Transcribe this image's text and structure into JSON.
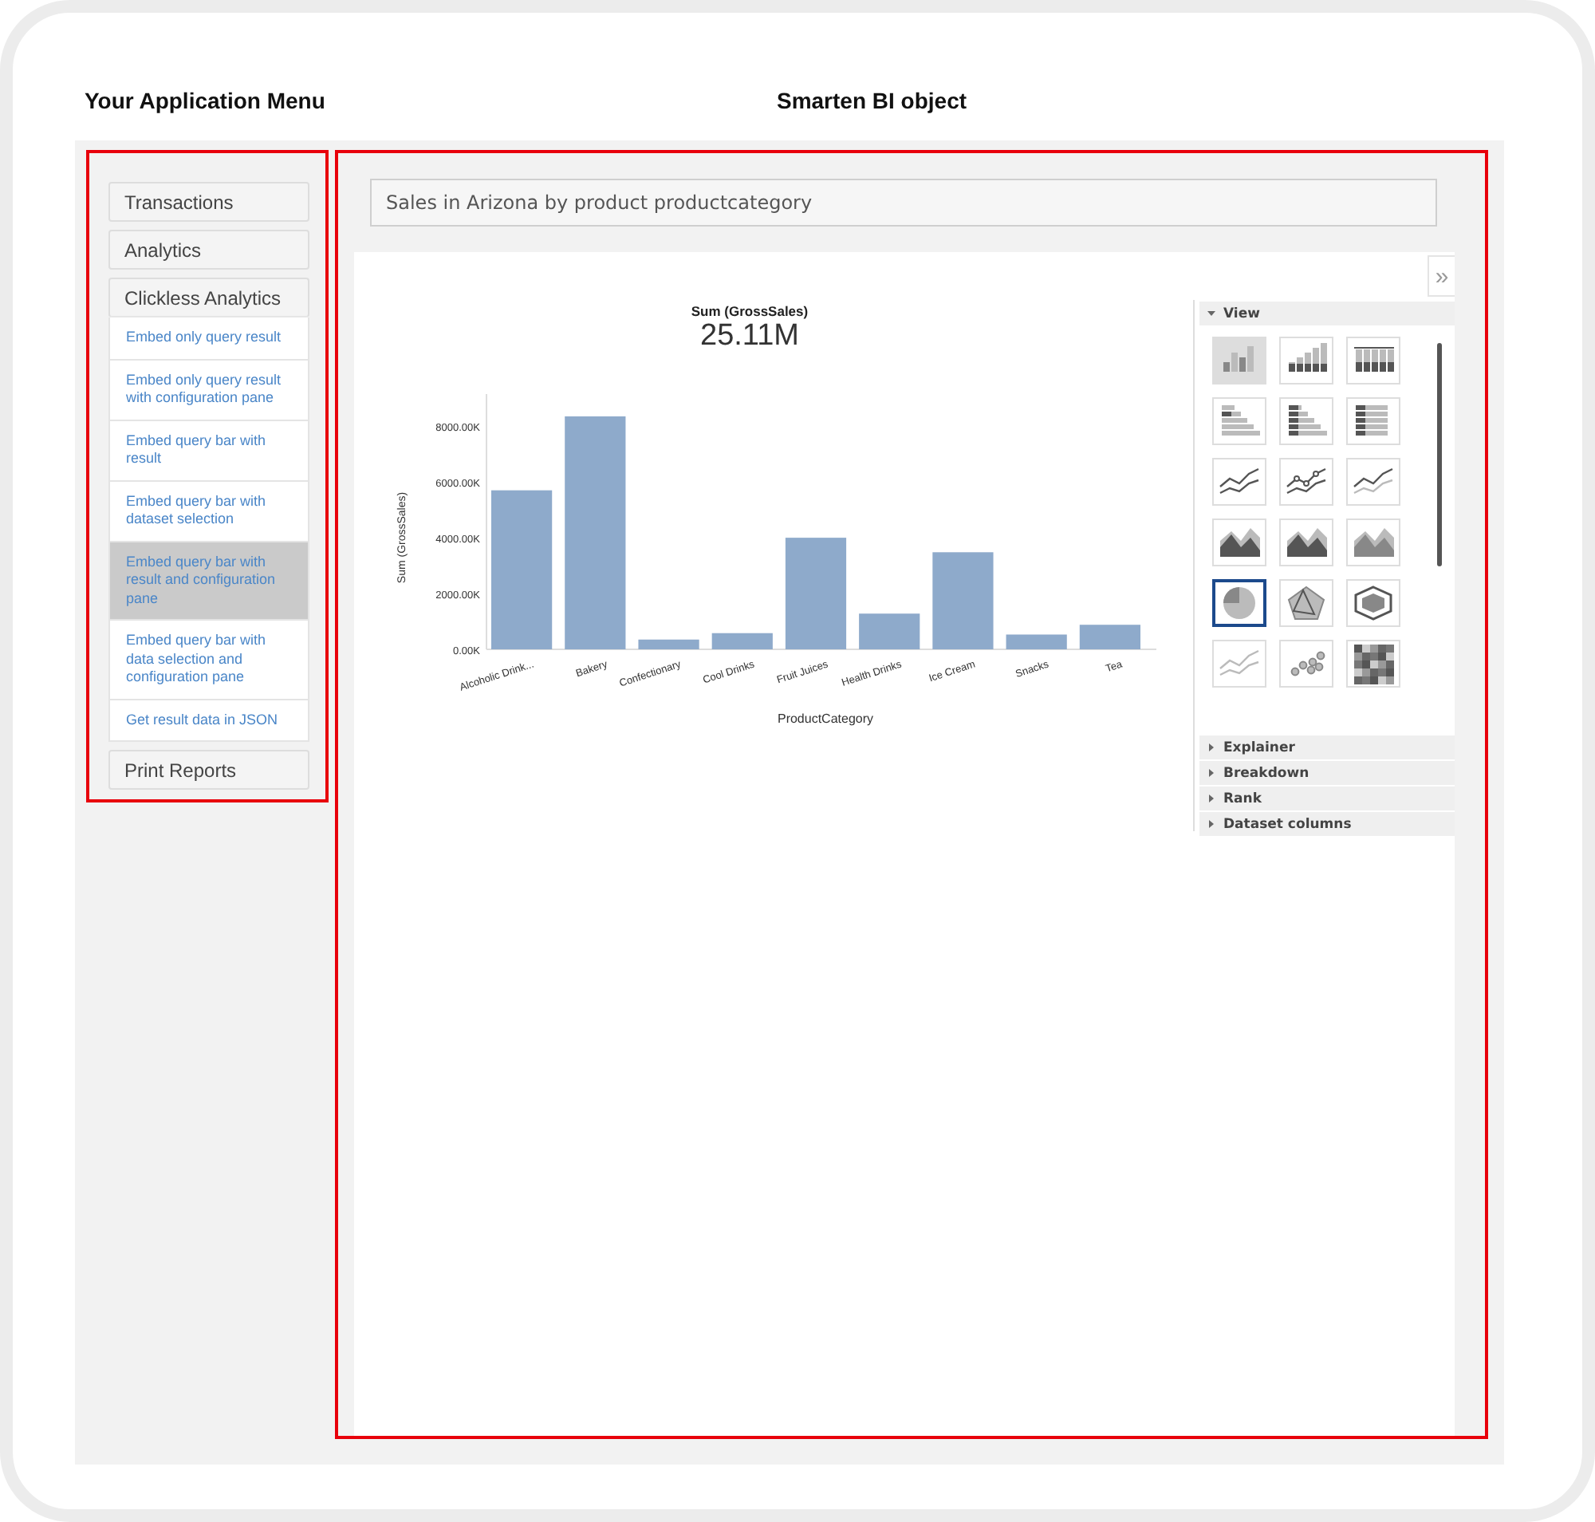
{
  "headings": {
    "menu": "Your Application Menu",
    "object": "Smarten BI object"
  },
  "menu": [
    {
      "label": "Transactions"
    },
    {
      "label": "Analytics"
    },
    {
      "label": "Clickless Analytics",
      "children": [
        {
          "label": "Embed only query result",
          "selected": false
        },
        {
          "label": "Embed only query result with configuration pane",
          "selected": false
        },
        {
          "label": "Embed query bar with result",
          "selected": false
        },
        {
          "label": "Embed query bar with dataset selection",
          "selected": false
        },
        {
          "label": "Embed query bar with result and configuration pane",
          "selected": true
        },
        {
          "label": "Embed query bar with data selection and configuration pane",
          "selected": false
        },
        {
          "label": "Get result data in JSON",
          "selected": false
        }
      ]
    },
    {
      "label": "Print Reports"
    }
  ],
  "query": {
    "value": "Sales in Arizona by product productcategory"
  },
  "expand_button": "»",
  "kpi": {
    "label": "Sum (GrossSales)",
    "value": "25.11M"
  },
  "chart_data": {
    "type": "bar",
    "xlabel": "ProductCategory",
    "ylabel": "Sum (GrossSales)",
    "categories": [
      "Alcoholic Drink...",
      "Bakery",
      "Confectionary",
      "Cool Drinks",
      "Fruit Juices",
      "Health Drinks",
      "Ice Cream",
      "Snacks",
      "Tea"
    ],
    "series": [
      {
        "color": "#8eaacb",
        "values": [
          5700,
          8350,
          350,
          580,
          4000,
          1280,
          3480,
          530,
          880
        ]
      }
    ],
    "ylim": [
      0,
      9150
    ],
    "yticks": [
      {
        "value": 0,
        "label": "0.00K"
      },
      {
        "value": 2000,
        "label": "2000.00K"
      },
      {
        "value": 4000,
        "label": "4000.00K"
      },
      {
        "value": 6000,
        "label": "6000.00K"
      },
      {
        "value": 8000,
        "label": "8000.00K"
      }
    ]
  },
  "panel": {
    "sections": [
      {
        "label": "View",
        "expanded": true
      },
      {
        "label": "Explainer",
        "expanded": false
      },
      {
        "label": "Breakdown",
        "expanded": false
      },
      {
        "label": "Rank",
        "expanded": false
      },
      {
        "label": "Dataset columns",
        "expanded": false
      }
    ],
    "chart_types": [
      {
        "kind": "column",
        "selected": false,
        "highlighted": true
      },
      {
        "kind": "stacked-column",
        "selected": false,
        "highlighted": false
      },
      {
        "kind": "percent-column",
        "selected": false,
        "highlighted": false
      },
      {
        "kind": "bar",
        "selected": false,
        "highlighted": false
      },
      {
        "kind": "stacked-bar",
        "selected": false,
        "highlighted": false
      },
      {
        "kind": "percent-bar",
        "selected": false,
        "highlighted": false
      },
      {
        "kind": "line",
        "selected": false,
        "highlighted": false
      },
      {
        "kind": "line-markers",
        "selected": false,
        "highlighted": false
      },
      {
        "kind": "percent-line",
        "selected": false,
        "highlighted": false
      },
      {
        "kind": "area",
        "selected": false,
        "highlighted": false
      },
      {
        "kind": "stacked-area",
        "selected": false,
        "highlighted": false
      },
      {
        "kind": "percent-area",
        "selected": false,
        "highlighted": false
      },
      {
        "kind": "pie",
        "selected": true,
        "highlighted": false
      },
      {
        "kind": "radar",
        "selected": false,
        "highlighted": false
      },
      {
        "kind": "polar",
        "selected": false,
        "highlighted": false
      },
      {
        "kind": "trend",
        "selected": false,
        "highlighted": false
      },
      {
        "kind": "bubble",
        "selected": false,
        "highlighted": false
      },
      {
        "kind": "heatmap",
        "selected": false,
        "highlighted": false
      }
    ]
  }
}
